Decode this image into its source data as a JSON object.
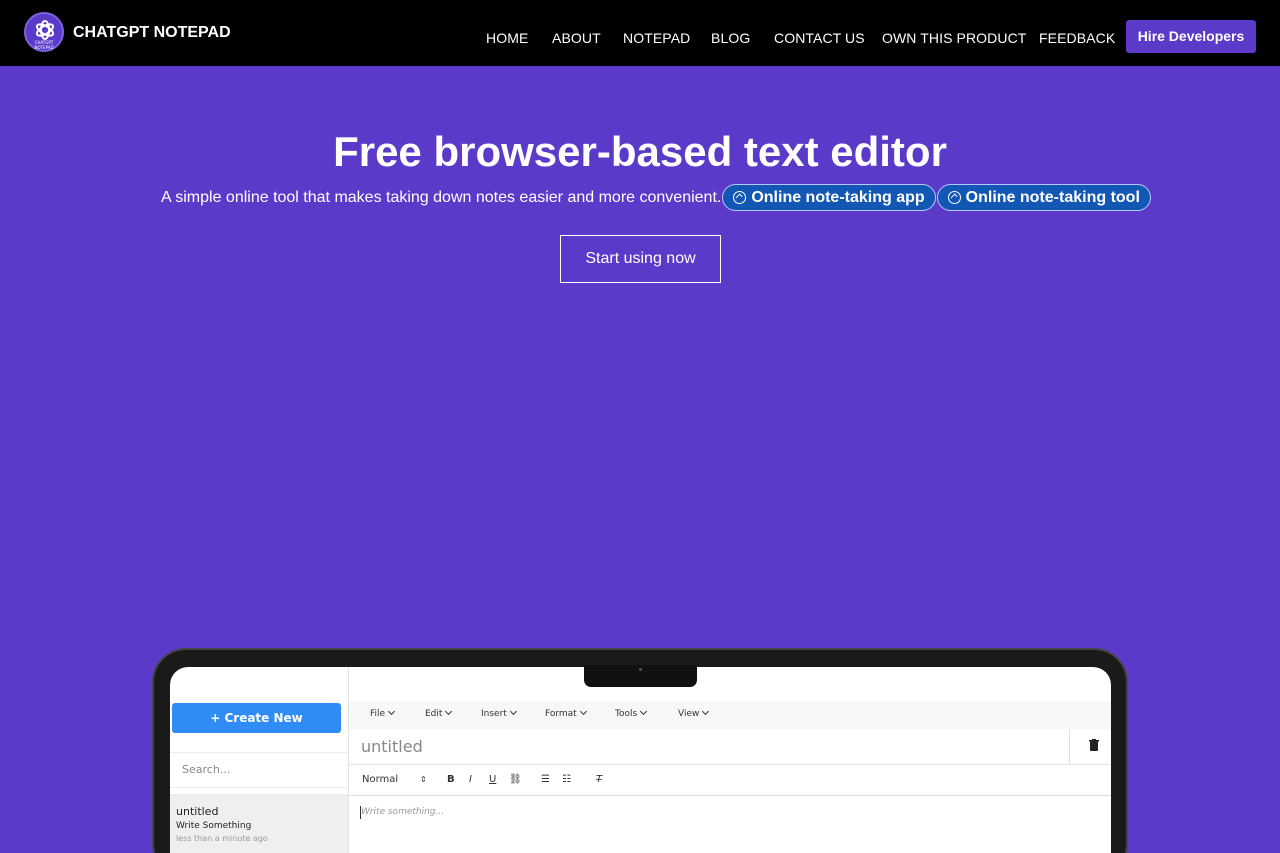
{
  "header": {
    "brand": "CHATGPT NOTEPAD",
    "logo_text": "CHATGPT NOTEPAD",
    "nav": [
      "HOME",
      "ABOUT",
      "NOTEPAD",
      "BLOG",
      "CONTACT US",
      "OWN THIS PRODUCT",
      "FEEDBACK"
    ],
    "hire_label": "Hire Developers"
  },
  "hero": {
    "title": "Free browser-based text editor",
    "subtitle": "A simple online tool that makes taking down notes easier and more convenient.",
    "tags": [
      "Online note-taking app",
      "Online note-taking tool"
    ],
    "cta_label": "Start using now"
  },
  "app": {
    "create_label": "+ Create New",
    "search_placeholder": "Search...",
    "note": {
      "title": "untitled",
      "snippet": "Write Something",
      "time": "less than a minute ago"
    },
    "menus": [
      "File",
      "Edit",
      "Insert",
      "Format",
      "Tools",
      "View"
    ],
    "doc_title": "untitled",
    "style_select": "Normal",
    "editor_placeholder": "Write something..."
  },
  "colors": {
    "background": "#5b3ac9",
    "topbar": "#000000",
    "pill": "#1357b5",
    "create_button": "#2f8cf5"
  }
}
